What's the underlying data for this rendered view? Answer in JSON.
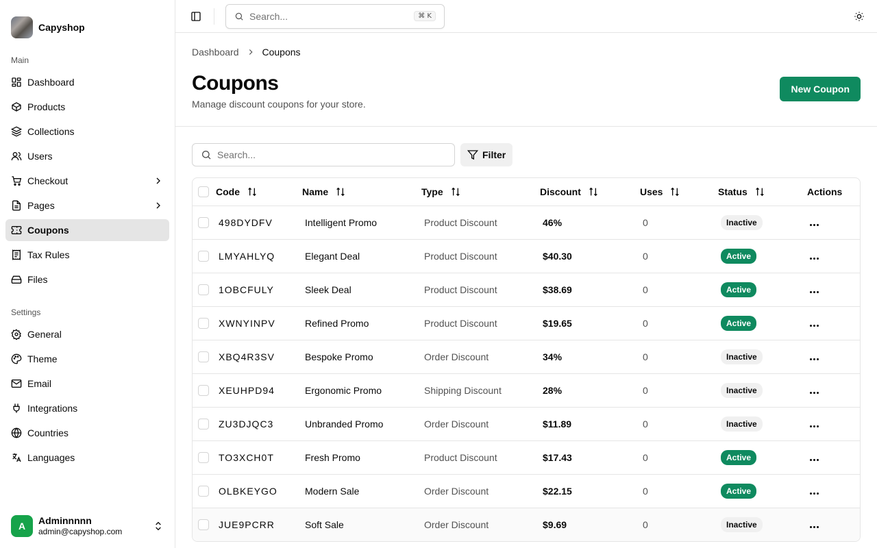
{
  "brand": {
    "name": "Capyshop"
  },
  "sidebar": {
    "main_label": "Main",
    "main_items": [
      {
        "label": "Dashboard",
        "icon": "layout-dashboard-icon"
      },
      {
        "label": "Products",
        "icon": "package-icon"
      },
      {
        "label": "Collections",
        "icon": "layers-icon"
      },
      {
        "label": "Users",
        "icon": "users-icon"
      },
      {
        "label": "Checkout",
        "icon": "shopping-cart-icon"
      },
      {
        "label": "Pages",
        "icon": "file-text-icon"
      },
      {
        "label": "Coupons",
        "icon": "ticket-icon"
      },
      {
        "label": "Tax Rules",
        "icon": "receipt-icon"
      },
      {
        "label": "Files",
        "icon": "hard-drive-icon"
      }
    ],
    "settings_label": "Settings",
    "settings_items": [
      {
        "label": "General",
        "icon": "settings-icon"
      },
      {
        "label": "Theme",
        "icon": "palette-icon"
      },
      {
        "label": "Email",
        "icon": "mail-icon"
      },
      {
        "label": "Integrations",
        "icon": "plug-icon"
      },
      {
        "label": "Countries",
        "icon": "globe-icon"
      },
      {
        "label": "Languages",
        "icon": "languages-icon"
      }
    ]
  },
  "user": {
    "initial": "A",
    "name": "Adminnnnn",
    "email": "admin@capyshop.com"
  },
  "topbar": {
    "search_placeholder": "Search...",
    "shortcut": "⌘ K"
  },
  "breadcrumb": {
    "root": "Dashboard",
    "current": "Coupons"
  },
  "page": {
    "title": "Coupons",
    "subtitle": "Manage discount coupons for your store.",
    "new_button": "New Coupon"
  },
  "table_toolbar": {
    "search_placeholder": "Search...",
    "filter_label": "Filter"
  },
  "table": {
    "columns": [
      "Code",
      "Name",
      "Type",
      "Discount",
      "Uses",
      "Status",
      "Actions"
    ],
    "rows": [
      {
        "code": "498DYDFV",
        "name": "Intelligent Promo",
        "type": "Product Discount",
        "discount": "46%",
        "uses": "0",
        "status": "Inactive"
      },
      {
        "code": "LMYAHLYQ",
        "name": "Elegant Deal",
        "type": "Product Discount",
        "discount": "$40.30",
        "uses": "0",
        "status": "Active"
      },
      {
        "code": "1OBCFULY",
        "name": "Sleek Deal",
        "type": "Product Discount",
        "discount": "$38.69",
        "uses": "0",
        "status": "Active"
      },
      {
        "code": "XWNYINPV",
        "name": "Refined Promo",
        "type": "Product Discount",
        "discount": "$19.65",
        "uses": "0",
        "status": "Active"
      },
      {
        "code": "XBQ4R3SV",
        "name": "Bespoke Promo",
        "type": "Order Discount",
        "discount": "34%",
        "uses": "0",
        "status": "Inactive"
      },
      {
        "code": "XEUHPD94",
        "name": "Ergonomic Promo",
        "type": "Shipping Discount",
        "discount": "28%",
        "uses": "0",
        "status": "Inactive"
      },
      {
        "code": "ZU3DJQC3",
        "name": "Unbranded Promo",
        "type": "Order Discount",
        "discount": "$11.89",
        "uses": "0",
        "status": "Inactive"
      },
      {
        "code": "TO3XCH0T",
        "name": "Fresh Promo",
        "type": "Product Discount",
        "discount": "$17.43",
        "uses": "0",
        "status": "Active"
      },
      {
        "code": "OLBKEYGO",
        "name": "Modern Sale",
        "type": "Order Discount",
        "discount": "$22.15",
        "uses": "0",
        "status": "Active"
      },
      {
        "code": "JUE9PCRR",
        "name": "Soft Sale",
        "type": "Order Discount",
        "discount": "$9.69",
        "uses": "0",
        "status": "Inactive"
      }
    ]
  },
  "colors": {
    "accent": "#0f8a5f",
    "active_nav": "#e5e5e5",
    "avatar": "#16a34a"
  }
}
